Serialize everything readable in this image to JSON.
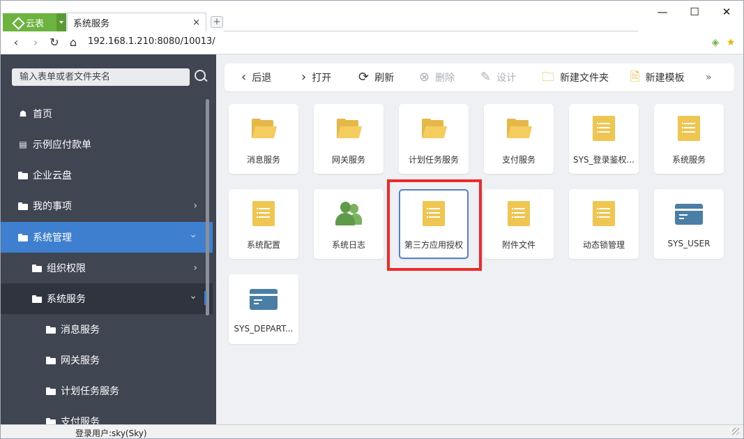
{
  "browser": {
    "app_tab_label": "云表",
    "page_tab_title": "系统服务",
    "close_glyph": "×",
    "new_tab_glyph": "+",
    "url": "192.168.1.210:8080/10013/",
    "minimize_glyph": "—",
    "maximize_glyph": "☐",
    "close_window_glyph": "✕"
  },
  "sidebar": {
    "search_placeholder": "输入表单或者文件夹名",
    "items": [
      {
        "label": "首页",
        "icon": "home-icon"
      },
      {
        "label": "示例应付款单",
        "icon": "document-icon"
      },
      {
        "label": "企业云盘",
        "icon": "folder-icon"
      },
      {
        "label": "我的事项",
        "icon": "folder-icon",
        "arrow": "›"
      },
      {
        "label": "系统管理",
        "icon": "folder-icon",
        "arrow": "⌄",
        "state": "active"
      },
      {
        "label": "组织权限",
        "icon": "folder-icon",
        "arrow": "›"
      },
      {
        "label": "系统服务",
        "icon": "folder-icon",
        "arrow": "⌄",
        "state": "expanded"
      },
      {
        "label": "消息服务",
        "icon": "folder-icon"
      },
      {
        "label": "网关服务",
        "icon": "folder-icon"
      },
      {
        "label": "计划任务服务",
        "icon": "folder-icon"
      },
      {
        "label": "支付服务",
        "icon": "folder-icon"
      }
    ]
  },
  "toolbar": {
    "back": "后退",
    "open": "打开",
    "refresh": "刷新",
    "delete": "删除",
    "design": "设计",
    "new_folder": "新建文件夹",
    "new_template": "新建模板",
    "more": "»"
  },
  "tiles": [
    {
      "label": "消息服务",
      "type": "folder"
    },
    {
      "label": "网关服务",
      "type": "folder"
    },
    {
      "label": "计划任务服务",
      "type": "folder"
    },
    {
      "label": "支付服务",
      "type": "folder"
    },
    {
      "label": "SYS_登录鉴权...",
      "type": "document"
    },
    {
      "label": "系统服务",
      "type": "document"
    },
    {
      "label": "系统配置",
      "type": "document"
    },
    {
      "label": "系统日志",
      "type": "users"
    },
    {
      "label": "第三方应用授权",
      "type": "document",
      "selected": true
    },
    {
      "label": "附件文件",
      "type": "document"
    },
    {
      "label": "动态锁管理",
      "type": "document"
    },
    {
      "label": "SYS_USER",
      "type": "table"
    },
    {
      "label": "SYS_DEPART...",
      "type": "table"
    }
  ],
  "status": {
    "user": "登录用户:sky(Sky)"
  },
  "colors": {
    "brand_green": "#6cb33f",
    "sidebar_bg": "#3f4551",
    "active_blue": "#3f7fd0",
    "folder_yellow": "#f4cd5e",
    "highlight_red": "#ee2a2a"
  }
}
